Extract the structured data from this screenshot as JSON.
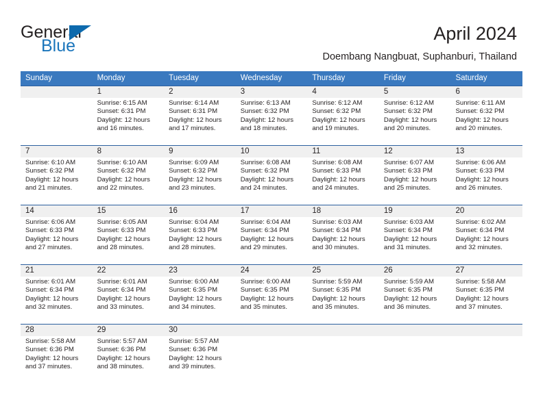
{
  "brand": {
    "name_part1": "General",
    "name_part2": "Blue",
    "triangle_icon": "triangle-icon",
    "accent_color": "#1a75bb"
  },
  "header": {
    "title": "April 2024",
    "subtitle": "Doembang Nangbuat, Suphanburi, Thailand"
  },
  "calendar": {
    "header_bg_color": "#3a79bf",
    "separator_color": "#2b5f9e",
    "daynum_bg_color": "#f0f0f0",
    "weekdays": [
      "Sunday",
      "Monday",
      "Tuesday",
      "Wednesday",
      "Thursday",
      "Friday",
      "Saturday"
    ],
    "weeks": [
      [
        {
          "day": "",
          "sunrise": "",
          "sunset": "",
          "daylight_1": "",
          "daylight_2": ""
        },
        {
          "day": "1",
          "sunrise": "Sunrise: 6:15 AM",
          "sunset": "Sunset: 6:31 PM",
          "daylight_1": "Daylight: 12 hours",
          "daylight_2": "and 16 minutes."
        },
        {
          "day": "2",
          "sunrise": "Sunrise: 6:14 AM",
          "sunset": "Sunset: 6:31 PM",
          "daylight_1": "Daylight: 12 hours",
          "daylight_2": "and 17 minutes."
        },
        {
          "day": "3",
          "sunrise": "Sunrise: 6:13 AM",
          "sunset": "Sunset: 6:32 PM",
          "daylight_1": "Daylight: 12 hours",
          "daylight_2": "and 18 minutes."
        },
        {
          "day": "4",
          "sunrise": "Sunrise: 6:12 AM",
          "sunset": "Sunset: 6:32 PM",
          "daylight_1": "Daylight: 12 hours",
          "daylight_2": "and 19 minutes."
        },
        {
          "day": "5",
          "sunrise": "Sunrise: 6:12 AM",
          "sunset": "Sunset: 6:32 PM",
          "daylight_1": "Daylight: 12 hours",
          "daylight_2": "and 20 minutes."
        },
        {
          "day": "6",
          "sunrise": "Sunrise: 6:11 AM",
          "sunset": "Sunset: 6:32 PM",
          "daylight_1": "Daylight: 12 hours",
          "daylight_2": "and 20 minutes."
        }
      ],
      [
        {
          "day": "7",
          "sunrise": "Sunrise: 6:10 AM",
          "sunset": "Sunset: 6:32 PM",
          "daylight_1": "Daylight: 12 hours",
          "daylight_2": "and 21 minutes."
        },
        {
          "day": "8",
          "sunrise": "Sunrise: 6:10 AM",
          "sunset": "Sunset: 6:32 PM",
          "daylight_1": "Daylight: 12 hours",
          "daylight_2": "and 22 minutes."
        },
        {
          "day": "9",
          "sunrise": "Sunrise: 6:09 AM",
          "sunset": "Sunset: 6:32 PM",
          "daylight_1": "Daylight: 12 hours",
          "daylight_2": "and 23 minutes."
        },
        {
          "day": "10",
          "sunrise": "Sunrise: 6:08 AM",
          "sunset": "Sunset: 6:32 PM",
          "daylight_1": "Daylight: 12 hours",
          "daylight_2": "and 24 minutes."
        },
        {
          "day": "11",
          "sunrise": "Sunrise: 6:08 AM",
          "sunset": "Sunset: 6:33 PM",
          "daylight_1": "Daylight: 12 hours",
          "daylight_2": "and 24 minutes."
        },
        {
          "day": "12",
          "sunrise": "Sunrise: 6:07 AM",
          "sunset": "Sunset: 6:33 PM",
          "daylight_1": "Daylight: 12 hours",
          "daylight_2": "and 25 minutes."
        },
        {
          "day": "13",
          "sunrise": "Sunrise: 6:06 AM",
          "sunset": "Sunset: 6:33 PM",
          "daylight_1": "Daylight: 12 hours",
          "daylight_2": "and 26 minutes."
        }
      ],
      [
        {
          "day": "14",
          "sunrise": "Sunrise: 6:06 AM",
          "sunset": "Sunset: 6:33 PM",
          "daylight_1": "Daylight: 12 hours",
          "daylight_2": "and 27 minutes."
        },
        {
          "day": "15",
          "sunrise": "Sunrise: 6:05 AM",
          "sunset": "Sunset: 6:33 PM",
          "daylight_1": "Daylight: 12 hours",
          "daylight_2": "and 28 minutes."
        },
        {
          "day": "16",
          "sunrise": "Sunrise: 6:04 AM",
          "sunset": "Sunset: 6:33 PM",
          "daylight_1": "Daylight: 12 hours",
          "daylight_2": "and 28 minutes."
        },
        {
          "day": "17",
          "sunrise": "Sunrise: 6:04 AM",
          "sunset": "Sunset: 6:34 PM",
          "daylight_1": "Daylight: 12 hours",
          "daylight_2": "and 29 minutes."
        },
        {
          "day": "18",
          "sunrise": "Sunrise: 6:03 AM",
          "sunset": "Sunset: 6:34 PM",
          "daylight_1": "Daylight: 12 hours",
          "daylight_2": "and 30 minutes."
        },
        {
          "day": "19",
          "sunrise": "Sunrise: 6:03 AM",
          "sunset": "Sunset: 6:34 PM",
          "daylight_1": "Daylight: 12 hours",
          "daylight_2": "and 31 minutes."
        },
        {
          "day": "20",
          "sunrise": "Sunrise: 6:02 AM",
          "sunset": "Sunset: 6:34 PM",
          "daylight_1": "Daylight: 12 hours",
          "daylight_2": "and 32 minutes."
        }
      ],
      [
        {
          "day": "21",
          "sunrise": "Sunrise: 6:01 AM",
          "sunset": "Sunset: 6:34 PM",
          "daylight_1": "Daylight: 12 hours",
          "daylight_2": "and 32 minutes."
        },
        {
          "day": "22",
          "sunrise": "Sunrise: 6:01 AM",
          "sunset": "Sunset: 6:34 PM",
          "daylight_1": "Daylight: 12 hours",
          "daylight_2": "and 33 minutes."
        },
        {
          "day": "23",
          "sunrise": "Sunrise: 6:00 AM",
          "sunset": "Sunset: 6:35 PM",
          "daylight_1": "Daylight: 12 hours",
          "daylight_2": "and 34 minutes."
        },
        {
          "day": "24",
          "sunrise": "Sunrise: 6:00 AM",
          "sunset": "Sunset: 6:35 PM",
          "daylight_1": "Daylight: 12 hours",
          "daylight_2": "and 35 minutes."
        },
        {
          "day": "25",
          "sunrise": "Sunrise: 5:59 AM",
          "sunset": "Sunset: 6:35 PM",
          "daylight_1": "Daylight: 12 hours",
          "daylight_2": "and 35 minutes."
        },
        {
          "day": "26",
          "sunrise": "Sunrise: 5:59 AM",
          "sunset": "Sunset: 6:35 PM",
          "daylight_1": "Daylight: 12 hours",
          "daylight_2": "and 36 minutes."
        },
        {
          "day": "27",
          "sunrise": "Sunrise: 5:58 AM",
          "sunset": "Sunset: 6:35 PM",
          "daylight_1": "Daylight: 12 hours",
          "daylight_2": "and 37 minutes."
        }
      ],
      [
        {
          "day": "28",
          "sunrise": "Sunrise: 5:58 AM",
          "sunset": "Sunset: 6:36 PM",
          "daylight_1": "Daylight: 12 hours",
          "daylight_2": "and 37 minutes."
        },
        {
          "day": "29",
          "sunrise": "Sunrise: 5:57 AM",
          "sunset": "Sunset: 6:36 PM",
          "daylight_1": "Daylight: 12 hours",
          "daylight_2": "and 38 minutes."
        },
        {
          "day": "30",
          "sunrise": "Sunrise: 5:57 AM",
          "sunset": "Sunset: 6:36 PM",
          "daylight_1": "Daylight: 12 hours",
          "daylight_2": "and 39 minutes."
        },
        {
          "day": "",
          "sunrise": "",
          "sunset": "",
          "daylight_1": "",
          "daylight_2": ""
        },
        {
          "day": "",
          "sunrise": "",
          "sunset": "",
          "daylight_1": "",
          "daylight_2": ""
        },
        {
          "day": "",
          "sunrise": "",
          "sunset": "",
          "daylight_1": "",
          "daylight_2": ""
        },
        {
          "day": "",
          "sunrise": "",
          "sunset": "",
          "daylight_1": "",
          "daylight_2": ""
        }
      ]
    ]
  }
}
